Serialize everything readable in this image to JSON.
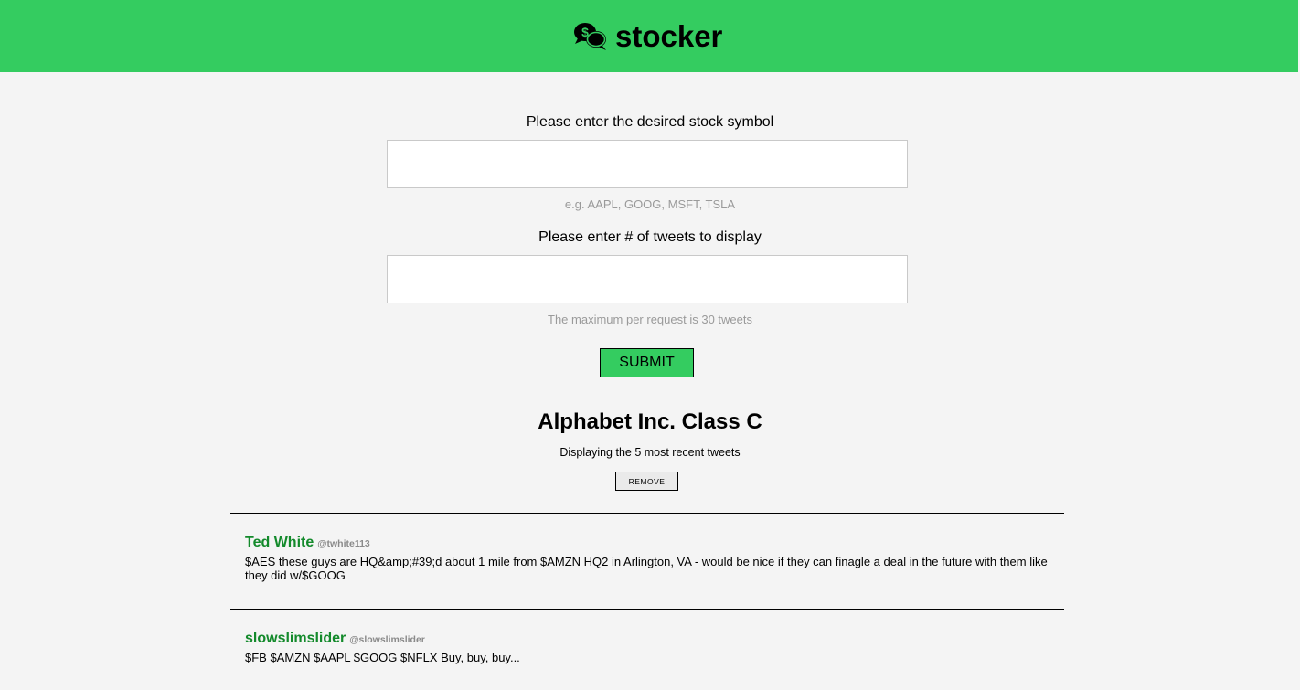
{
  "header": {
    "logo_icon": "dollar-chat-bubbles-icon",
    "title": "stocker",
    "bg_color": "#34cc60"
  },
  "form": {
    "symbol_label": "Please enter the desired stock symbol",
    "symbol_value": "",
    "symbol_hint": "e.g. AAPL, GOOG, MSFT, TSLA",
    "count_label": "Please enter # of tweets to display",
    "count_value": "",
    "count_hint": "The maximum per request is 30 tweets",
    "submit_label": "SUBMIT"
  },
  "result": {
    "company": "Alphabet Inc. Class C",
    "count_text": "Displaying the 5 most recent tweets",
    "remove_label": "REMOVE",
    "tweets": [
      {
        "name": "Ted White",
        "handle": "@twhite113",
        "text": "$AES these guys are HQ&amp;#39;d about 1 mile from $AMZN HQ2 in Arlington, VA - would be nice if they can finagle a deal in the future with them like they did w/$GOOG"
      },
      {
        "name": "slowslimslider",
        "handle": "@slowslimslider",
        "text": "$FB $AMZN $AAPL $GOOG $NFLX Buy, buy, buy..."
      }
    ]
  },
  "colors": {
    "accent": "#34cc60",
    "username": "#138a2b",
    "background": "#f4f4f4",
    "hint": "#9a9a9a"
  }
}
